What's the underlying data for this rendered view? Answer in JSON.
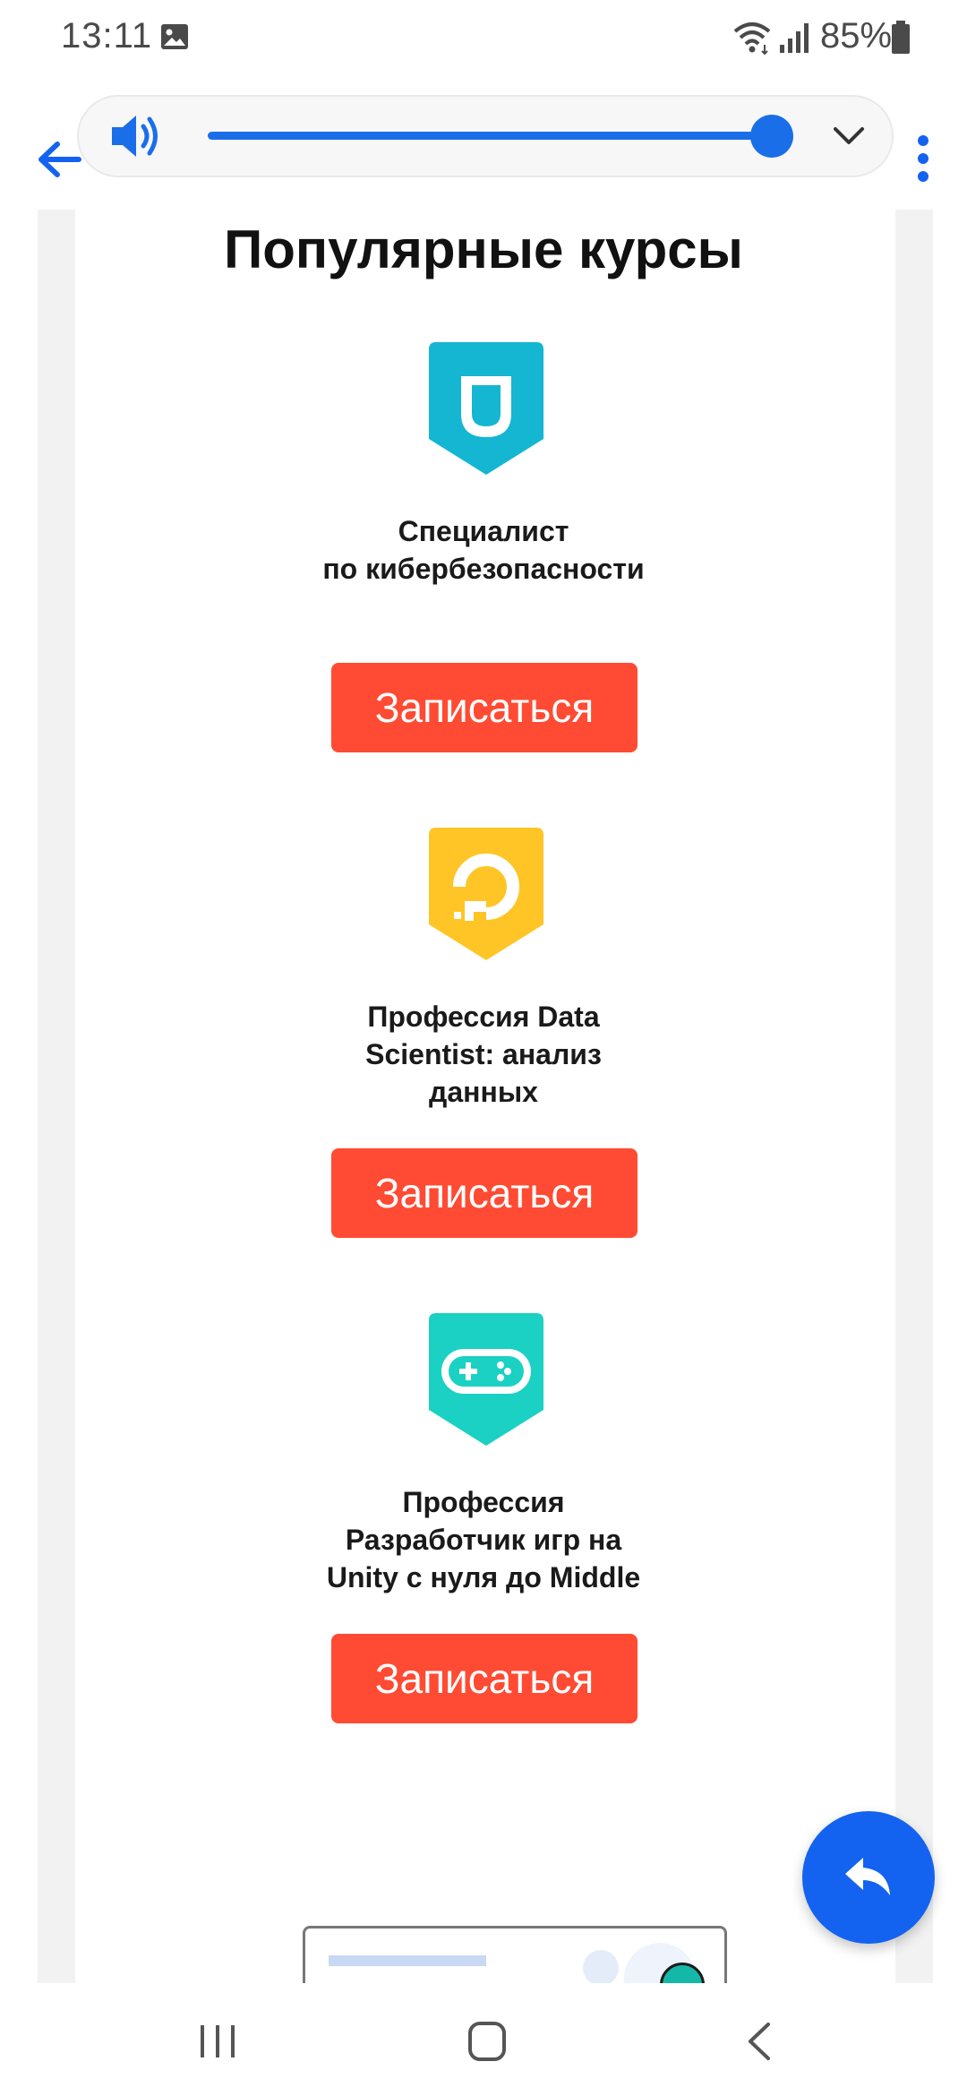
{
  "status_bar": {
    "time": "13:11",
    "battery_percent": "85%",
    "icons": [
      "gallery-icon",
      "wifi-icon",
      "signal-icon",
      "battery-icon"
    ]
  },
  "media_bar": {
    "volume_level": 0.95,
    "icons": [
      "back-arrow-icon",
      "speaker-icon",
      "chevron-down-icon",
      "more-vert-icon"
    ],
    "accent_color": "#1a6fe8"
  },
  "section": {
    "title": "Популярные курсы"
  },
  "courses": [
    {
      "title_lines": [
        "Специалист",
        "по кибербезопасности"
      ],
      "button_label": "Записаться",
      "badge_color": "#14b6d2",
      "icon": "shield-icon"
    },
    {
      "title_lines": [
        "Профессия Data",
        "Scientist: анализ",
        "данных"
      ],
      "button_label": "Записаться",
      "badge_color": "#ffc526",
      "icon": "digitalocean-icon"
    },
    {
      "title_lines": [
        "Профессия",
        "Разработчик игр на",
        "Unity с нуля до Middle"
      ],
      "button_label": "Записаться",
      "badge_color": "#1ad1c3",
      "icon": "gamepad-icon"
    }
  ],
  "colors": {
    "button": "#ff4b33",
    "fab": "#1463f0"
  },
  "fab": {
    "icon": "reply-icon"
  },
  "nav": {
    "icons": [
      "recent-apps-icon",
      "home-icon",
      "back-icon"
    ]
  }
}
